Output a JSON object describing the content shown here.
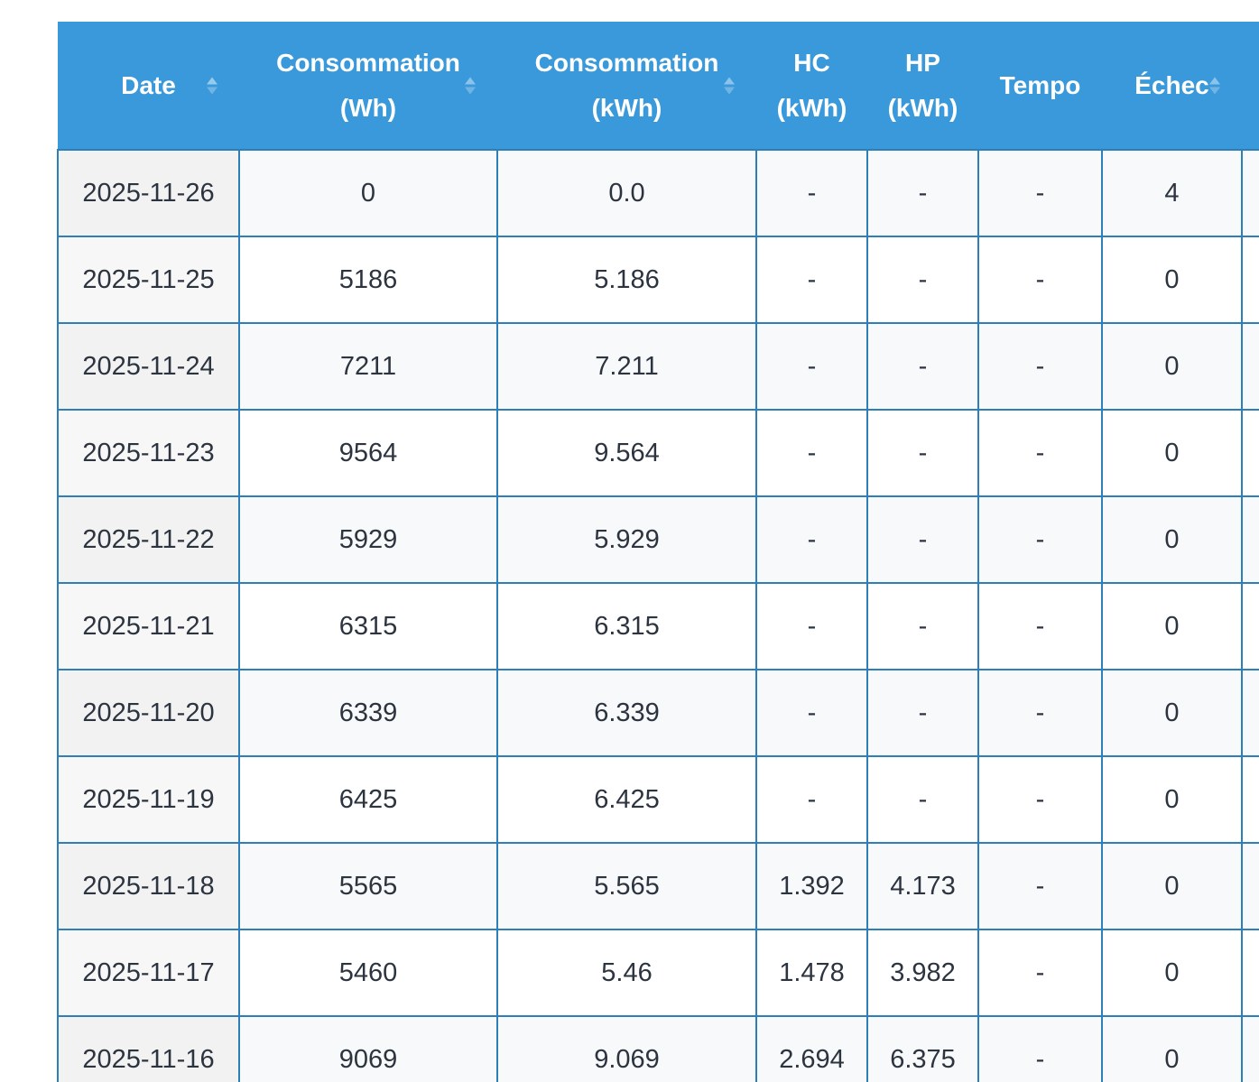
{
  "table": {
    "headers": {
      "date": "Date",
      "wh_line1": "Consommation",
      "wh_line2": "(Wh)",
      "kwh_line1": "Consommation",
      "kwh_line2": "(kWh)",
      "hc_line1": "HC",
      "hc_line2": "(kWh)",
      "hp_line1": "HP",
      "hp_line2": "(kWh)",
      "tempo": "Tempo",
      "echec": "Échec"
    },
    "rows": [
      {
        "date": "2025-11-26",
        "wh": "0",
        "kwh": "0.0",
        "hc": "-",
        "hp": "-",
        "tempo": "-",
        "echec": "4"
      },
      {
        "date": "2025-11-25",
        "wh": "5186",
        "kwh": "5.186",
        "hc": "-",
        "hp": "-",
        "tempo": "-",
        "echec": "0"
      },
      {
        "date": "2025-11-24",
        "wh": "7211",
        "kwh": "7.211",
        "hc": "-",
        "hp": "-",
        "tempo": "-",
        "echec": "0"
      },
      {
        "date": "2025-11-23",
        "wh": "9564",
        "kwh": "9.564",
        "hc": "-",
        "hp": "-",
        "tempo": "-",
        "echec": "0"
      },
      {
        "date": "2025-11-22",
        "wh": "5929",
        "kwh": "5.929",
        "hc": "-",
        "hp": "-",
        "tempo": "-",
        "echec": "0"
      },
      {
        "date": "2025-11-21",
        "wh": "6315",
        "kwh": "6.315",
        "hc": "-",
        "hp": "-",
        "tempo": "-",
        "echec": "0"
      },
      {
        "date": "2025-11-20",
        "wh": "6339",
        "kwh": "6.339",
        "hc": "-",
        "hp": "-",
        "tempo": "-",
        "echec": "0"
      },
      {
        "date": "2025-11-19",
        "wh": "6425",
        "kwh": "6.425",
        "hc": "-",
        "hp": "-",
        "tempo": "-",
        "echec": "0"
      },
      {
        "date": "2025-11-18",
        "wh": "5565",
        "kwh": "5.565",
        "hc": "1.392",
        "hp": "4.173",
        "tempo": "-",
        "echec": "0"
      },
      {
        "date": "2025-11-17",
        "wh": "5460",
        "kwh": "5.46",
        "hc": "1.478",
        "hp": "3.982",
        "tempo": "-",
        "echec": "0"
      },
      {
        "date": "2025-11-16",
        "wh": "9069",
        "kwh": "9.069",
        "hc": "2.694",
        "hp": "6.375",
        "tempo": "-",
        "echec": "0"
      }
    ]
  },
  "colors": {
    "header_bg": "#3a99db",
    "border": "#2e7fb8",
    "text": "#2c3440"
  }
}
